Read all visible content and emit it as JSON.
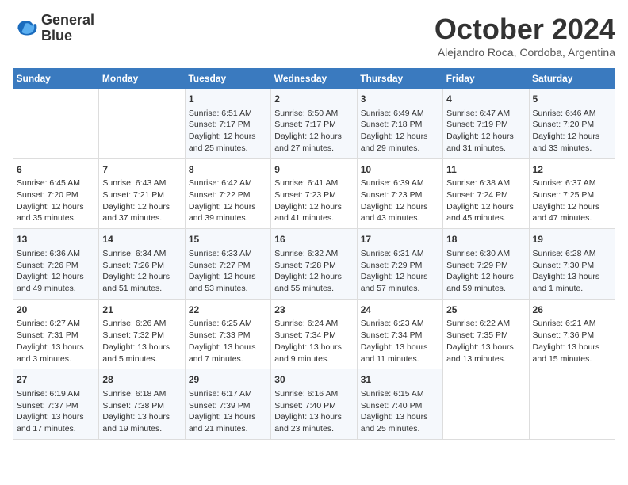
{
  "logo": {
    "line1": "General",
    "line2": "Blue"
  },
  "title": "October 2024",
  "location": "Alejandro Roca, Cordoba, Argentina",
  "days_of_week": [
    "Sunday",
    "Monday",
    "Tuesday",
    "Wednesday",
    "Thursday",
    "Friday",
    "Saturday"
  ],
  "weeks": [
    [
      {
        "day": "",
        "content": ""
      },
      {
        "day": "",
        "content": ""
      },
      {
        "day": "1",
        "content": "Sunrise: 6:51 AM\nSunset: 7:17 PM\nDaylight: 12 hours\nand 25 minutes."
      },
      {
        "day": "2",
        "content": "Sunrise: 6:50 AM\nSunset: 7:17 PM\nDaylight: 12 hours\nand 27 minutes."
      },
      {
        "day": "3",
        "content": "Sunrise: 6:49 AM\nSunset: 7:18 PM\nDaylight: 12 hours\nand 29 minutes."
      },
      {
        "day": "4",
        "content": "Sunrise: 6:47 AM\nSunset: 7:19 PM\nDaylight: 12 hours\nand 31 minutes."
      },
      {
        "day": "5",
        "content": "Sunrise: 6:46 AM\nSunset: 7:20 PM\nDaylight: 12 hours\nand 33 minutes."
      }
    ],
    [
      {
        "day": "6",
        "content": "Sunrise: 6:45 AM\nSunset: 7:20 PM\nDaylight: 12 hours\nand 35 minutes."
      },
      {
        "day": "7",
        "content": "Sunrise: 6:43 AM\nSunset: 7:21 PM\nDaylight: 12 hours\nand 37 minutes."
      },
      {
        "day": "8",
        "content": "Sunrise: 6:42 AM\nSunset: 7:22 PM\nDaylight: 12 hours\nand 39 minutes."
      },
      {
        "day": "9",
        "content": "Sunrise: 6:41 AM\nSunset: 7:23 PM\nDaylight: 12 hours\nand 41 minutes."
      },
      {
        "day": "10",
        "content": "Sunrise: 6:39 AM\nSunset: 7:23 PM\nDaylight: 12 hours\nand 43 minutes."
      },
      {
        "day": "11",
        "content": "Sunrise: 6:38 AM\nSunset: 7:24 PM\nDaylight: 12 hours\nand 45 minutes."
      },
      {
        "day": "12",
        "content": "Sunrise: 6:37 AM\nSunset: 7:25 PM\nDaylight: 12 hours\nand 47 minutes."
      }
    ],
    [
      {
        "day": "13",
        "content": "Sunrise: 6:36 AM\nSunset: 7:26 PM\nDaylight: 12 hours\nand 49 minutes."
      },
      {
        "day": "14",
        "content": "Sunrise: 6:34 AM\nSunset: 7:26 PM\nDaylight: 12 hours\nand 51 minutes."
      },
      {
        "day": "15",
        "content": "Sunrise: 6:33 AM\nSunset: 7:27 PM\nDaylight: 12 hours\nand 53 minutes."
      },
      {
        "day": "16",
        "content": "Sunrise: 6:32 AM\nSunset: 7:28 PM\nDaylight: 12 hours\nand 55 minutes."
      },
      {
        "day": "17",
        "content": "Sunrise: 6:31 AM\nSunset: 7:29 PM\nDaylight: 12 hours\nand 57 minutes."
      },
      {
        "day": "18",
        "content": "Sunrise: 6:30 AM\nSunset: 7:29 PM\nDaylight: 12 hours\nand 59 minutes."
      },
      {
        "day": "19",
        "content": "Sunrise: 6:28 AM\nSunset: 7:30 PM\nDaylight: 13 hours\nand 1 minute."
      }
    ],
    [
      {
        "day": "20",
        "content": "Sunrise: 6:27 AM\nSunset: 7:31 PM\nDaylight: 13 hours\nand 3 minutes."
      },
      {
        "day": "21",
        "content": "Sunrise: 6:26 AM\nSunset: 7:32 PM\nDaylight: 13 hours\nand 5 minutes."
      },
      {
        "day": "22",
        "content": "Sunrise: 6:25 AM\nSunset: 7:33 PM\nDaylight: 13 hours\nand 7 minutes."
      },
      {
        "day": "23",
        "content": "Sunrise: 6:24 AM\nSunset: 7:34 PM\nDaylight: 13 hours\nand 9 minutes."
      },
      {
        "day": "24",
        "content": "Sunrise: 6:23 AM\nSunset: 7:34 PM\nDaylight: 13 hours\nand 11 minutes."
      },
      {
        "day": "25",
        "content": "Sunrise: 6:22 AM\nSunset: 7:35 PM\nDaylight: 13 hours\nand 13 minutes."
      },
      {
        "day": "26",
        "content": "Sunrise: 6:21 AM\nSunset: 7:36 PM\nDaylight: 13 hours\nand 15 minutes."
      }
    ],
    [
      {
        "day": "27",
        "content": "Sunrise: 6:19 AM\nSunset: 7:37 PM\nDaylight: 13 hours\nand 17 minutes."
      },
      {
        "day": "28",
        "content": "Sunrise: 6:18 AM\nSunset: 7:38 PM\nDaylight: 13 hours\nand 19 minutes."
      },
      {
        "day": "29",
        "content": "Sunrise: 6:17 AM\nSunset: 7:39 PM\nDaylight: 13 hours\nand 21 minutes."
      },
      {
        "day": "30",
        "content": "Sunrise: 6:16 AM\nSunset: 7:40 PM\nDaylight: 13 hours\nand 23 minutes."
      },
      {
        "day": "31",
        "content": "Sunrise: 6:15 AM\nSunset: 7:40 PM\nDaylight: 13 hours\nand 25 minutes."
      },
      {
        "day": "",
        "content": ""
      },
      {
        "day": "",
        "content": ""
      }
    ]
  ]
}
